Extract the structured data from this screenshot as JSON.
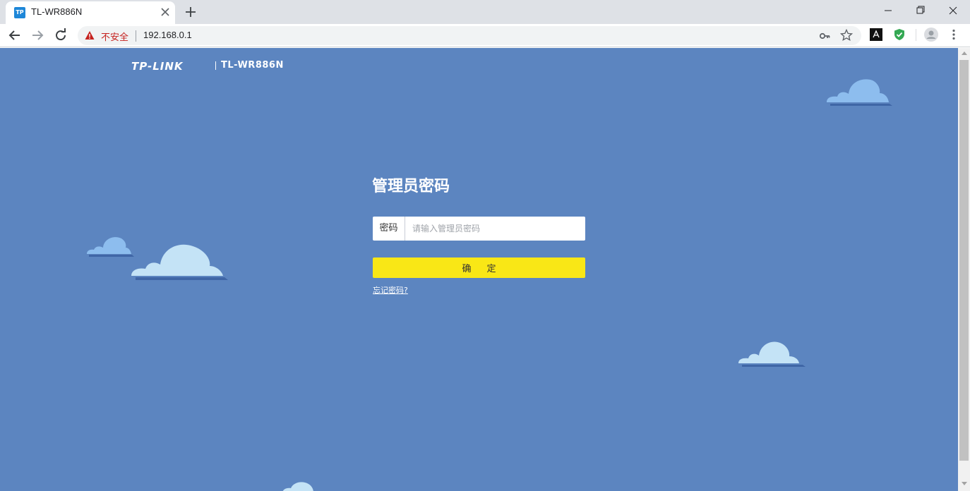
{
  "browser": {
    "tab": {
      "favicon_text": "TP",
      "title": "TL-WR886N"
    },
    "new_tab_label": "+",
    "address": {
      "security_label": "不安全",
      "url": "192.168.0.1"
    }
  },
  "page": {
    "logo_text": "TP-LINK",
    "model": "TL-WR886N",
    "title": "管理员密码",
    "password": {
      "label": "密码",
      "placeholder": "请输入管理员密码",
      "value": ""
    },
    "submit_label": "确定",
    "forgot_link": "忘记密码?"
  },
  "colors": {
    "page_bg": "#5c85c0",
    "button_bg": "#f9e716",
    "insecure_text": "#c5221f",
    "cloud_light": "#c4e3f6",
    "cloud_blue": "#8dbdee",
    "cloud_shadow": "#3f66a6"
  }
}
